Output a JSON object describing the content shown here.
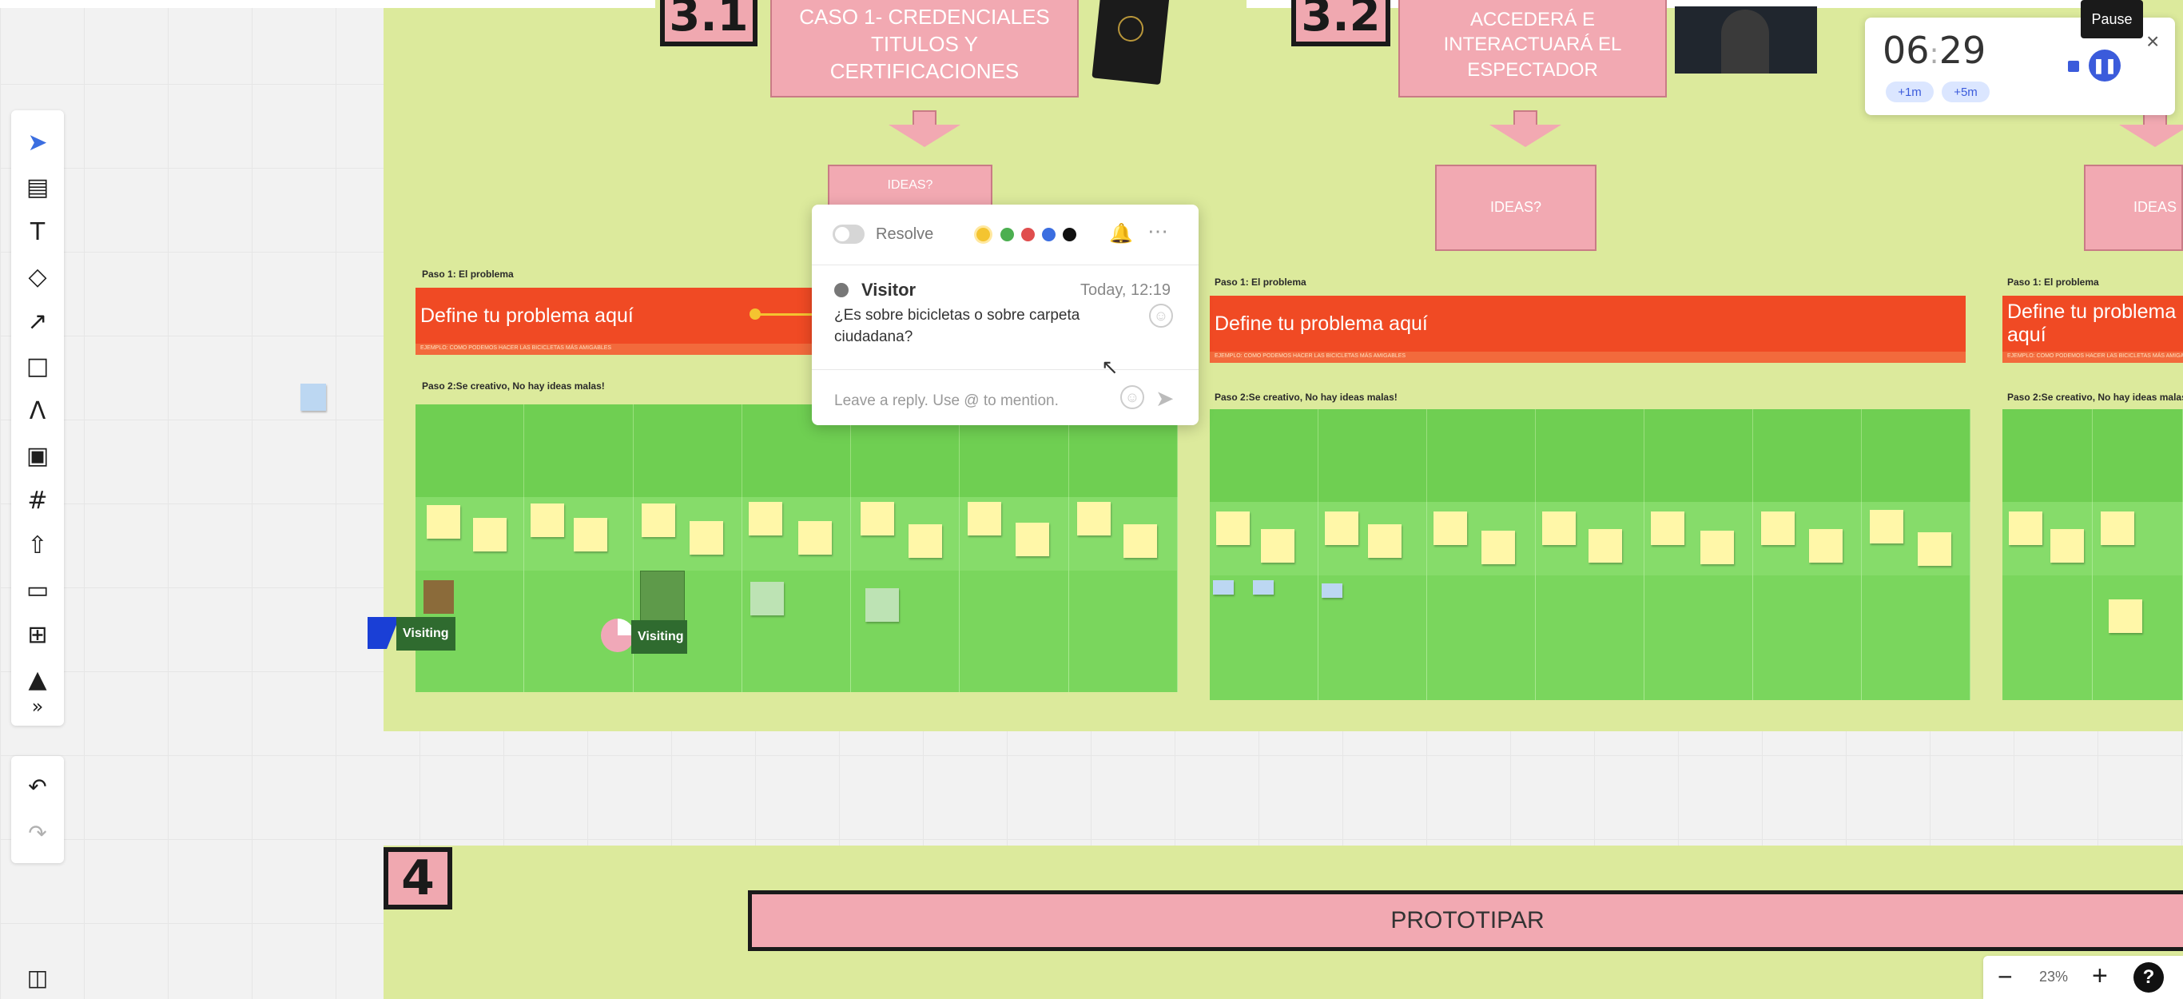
{
  "sections": {
    "s31_number": "3.1",
    "s31_card": "CASO 1- CREDENCIALES TITULOS Y CERTIFICACIONES",
    "s31_ideas": "IDEAS?",
    "s32_number": "3.2",
    "s32_card": "ACCEDERÁ E INTERACTUARÁ EL ESPECTADOR",
    "s32_ideas": "IDEAS?",
    "s33_ideas": "IDEAS",
    "s4_number": "4",
    "prototipar": "PROTOTIPAR"
  },
  "board": {
    "paso1": "Paso 1: El problema",
    "define": "Define tu problema aquí",
    "define_sub": "EJEMPLO: COMO PODEMOS HACER LAS BICICLETAS MÁS AMIGABLES",
    "paso2": "Paso 2:Se creativo, No hay ideas malas!"
  },
  "comment": {
    "resolve": "Resolve",
    "author": "Visitor",
    "time": "Today, 12:19",
    "text": "¿Es sobre bicicletas o sobre carpeta ciudadana?",
    "reply_placeholder": "Leave a reply. Use @ to mention.",
    "colors": [
      "#f4c430",
      "#4caf50",
      "#e04e4e",
      "#3b6ee0",
      "#111111"
    ]
  },
  "timer": {
    "minutes": "06",
    "seconds": "29",
    "add1": "+1m",
    "add5": "+5m",
    "pause_tooltip": "Pause",
    "close": "×"
  },
  "cursors": {
    "visiting1": "Visiting",
    "visiting2": "Visiting"
  },
  "zoom": {
    "minus": "−",
    "level": "23%",
    "plus": "+",
    "help": "?"
  },
  "toolbar": {
    "more": "»"
  }
}
